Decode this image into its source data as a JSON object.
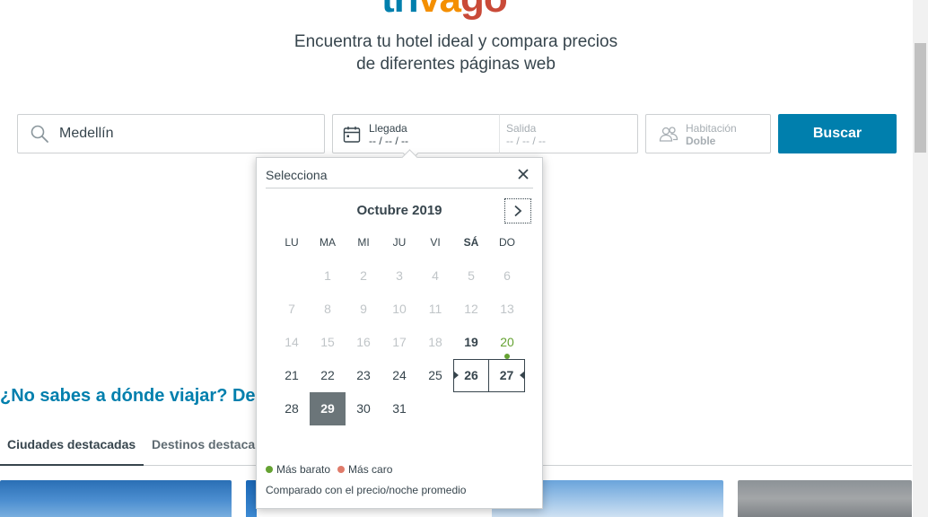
{
  "header": {
    "logo_parts": [
      "tri",
      "va",
      "go"
    ],
    "tagline_line1": "Encuentra tu hotel ideal y compara precios",
    "tagline_line2": "de diferentes páginas web"
  },
  "search": {
    "destination_value": "Medellín",
    "arrival_label": "Llegada",
    "arrival_value": "-- / -- / --",
    "departure_label": "Salida",
    "departure_value": "-- / -- / --",
    "room_label": "Habitación",
    "room_value": "Doble",
    "button_label": "Buscar"
  },
  "calendar": {
    "title": "Selecciona",
    "month": "Octubre 2019",
    "weekdays": [
      "LU",
      "MA",
      "MI",
      "JU",
      "VI",
      "SÁ",
      "DO"
    ],
    "weeks": [
      [
        "",
        "1",
        "2",
        "3",
        "4",
        "5",
        "6"
      ],
      [
        "7",
        "8",
        "9",
        "10",
        "11",
        "12",
        "13"
      ],
      [
        "14",
        "15",
        "16",
        "17",
        "18",
        "19",
        "20"
      ],
      [
        "21",
        "22",
        "23",
        "24",
        "25",
        "26",
        "27"
      ],
      [
        "28",
        "29",
        "30",
        "31",
        "",
        "",
        ""
      ]
    ],
    "legend_cheap": "Más barato",
    "legend_expensive": "Más caro",
    "note": "Comparado con el precio/noche promedio",
    "colors": {
      "cheap": "#65a232",
      "expensive": "#e07b6a"
    }
  },
  "promo": {
    "heading": "¿No sabes a dónde viajar? De",
    "tabs": [
      "Ciudades destacadas",
      "Destinos destaca"
    ]
  },
  "colors": {
    "accent": "#007fad",
    "text": "#37454d"
  }
}
